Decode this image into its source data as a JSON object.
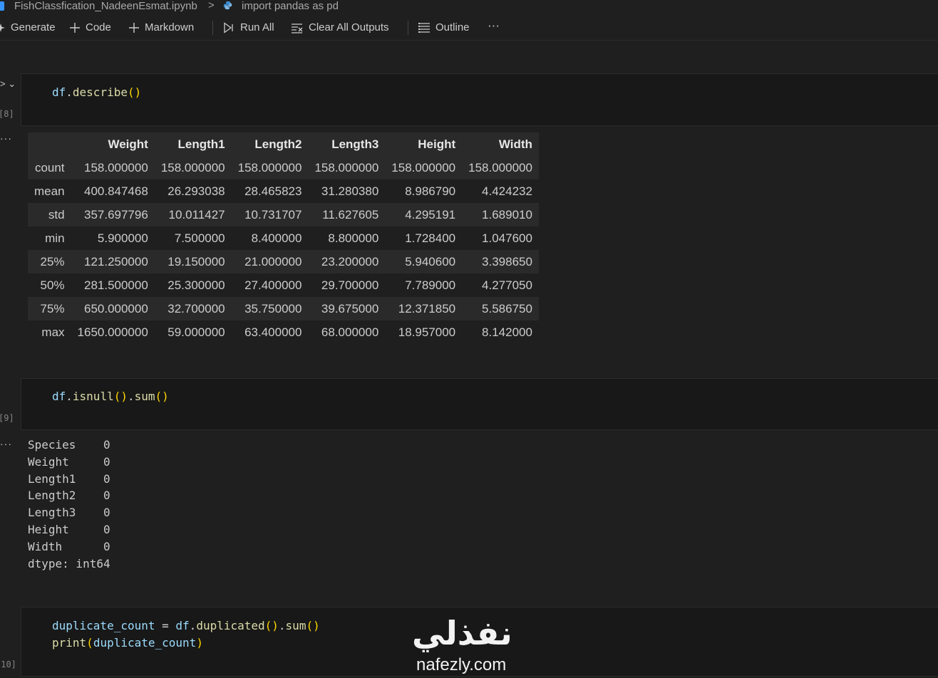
{
  "breadcrumb": {
    "file": "FishClassfication_NadeenEsmat.ipynb",
    "separator": ">",
    "symbol": "import pandas as pd"
  },
  "toolbar": {
    "generate": "Generate",
    "code": "Code",
    "markdown": "Markdown",
    "run_all": "Run All",
    "clear_all_outputs": "Clear All Outputs",
    "outline": "Outline",
    "more": "···"
  },
  "cells": [
    {
      "exec_label": "[8]",
      "code": "df.describe()",
      "output": {
        "columns": [
          "",
          "Weight",
          "Length1",
          "Length2",
          "Length3",
          "Height",
          "Width"
        ],
        "rows": [
          {
            "label": "count",
            "values": [
              "158.000000",
              "158.000000",
              "158.000000",
              "158.000000",
              "158.000000",
              "158.000000"
            ]
          },
          {
            "label": "mean",
            "values": [
              "400.847468",
              "26.293038",
              "28.465823",
              "31.280380",
              "8.986790",
              "4.424232"
            ]
          },
          {
            "label": "std",
            "values": [
              "357.697796",
              "10.011427",
              "10.731707",
              "11.627605",
              "4.295191",
              "1.689010"
            ]
          },
          {
            "label": "min",
            "values": [
              "5.900000",
              "7.500000",
              "8.400000",
              "8.800000",
              "1.728400",
              "1.047600"
            ]
          },
          {
            "label": "25%",
            "values": [
              "121.250000",
              "19.150000",
              "21.000000",
              "23.200000",
              "5.940600",
              "3.398650"
            ]
          },
          {
            "label": "50%",
            "values": [
              "281.500000",
              "25.300000",
              "27.400000",
              "29.700000",
              "7.789000",
              "4.277050"
            ]
          },
          {
            "label": "75%",
            "values": [
              "650.000000",
              "32.700000",
              "35.750000",
              "39.675000",
              "12.371850",
              "5.586750"
            ]
          },
          {
            "label": "max",
            "values": [
              "1650.000000",
              "59.000000",
              "63.400000",
              "68.000000",
              "18.957000",
              "8.142000"
            ]
          }
        ]
      }
    },
    {
      "exec_label": "[9]",
      "code": "df.isnull().sum()",
      "output_text": "Species    0\nWeight     0\nLength1    0\nLength2    0\nLength3    0\nHeight     0\nWidth      0\ndtype: int64"
    },
    {
      "exec_label": "[10]",
      "code_line1": "duplicate_count = df.duplicated().sum()",
      "code_line2": "print(duplicate_count)"
    }
  ],
  "watermark": {
    "arabic": "نفذلي",
    "latin": "nafezly.com"
  },
  "colors": {
    "background": "#1f1f1f",
    "cell_background": "#181818",
    "variable": "#9cdcfe",
    "function": "#dcdcaa",
    "bracket_level1": "#ffd700",
    "bracket_level2": "#da70d6"
  },
  "icons": {
    "notebook": "notebook-icon",
    "python": "python-icon",
    "generate": "sparkle-icon",
    "add": "plus-icon",
    "run_all": "run-all-icon",
    "clear_outputs": "clear-all-icon",
    "outline": "list-icon",
    "more": "ellipsis-icon"
  }
}
